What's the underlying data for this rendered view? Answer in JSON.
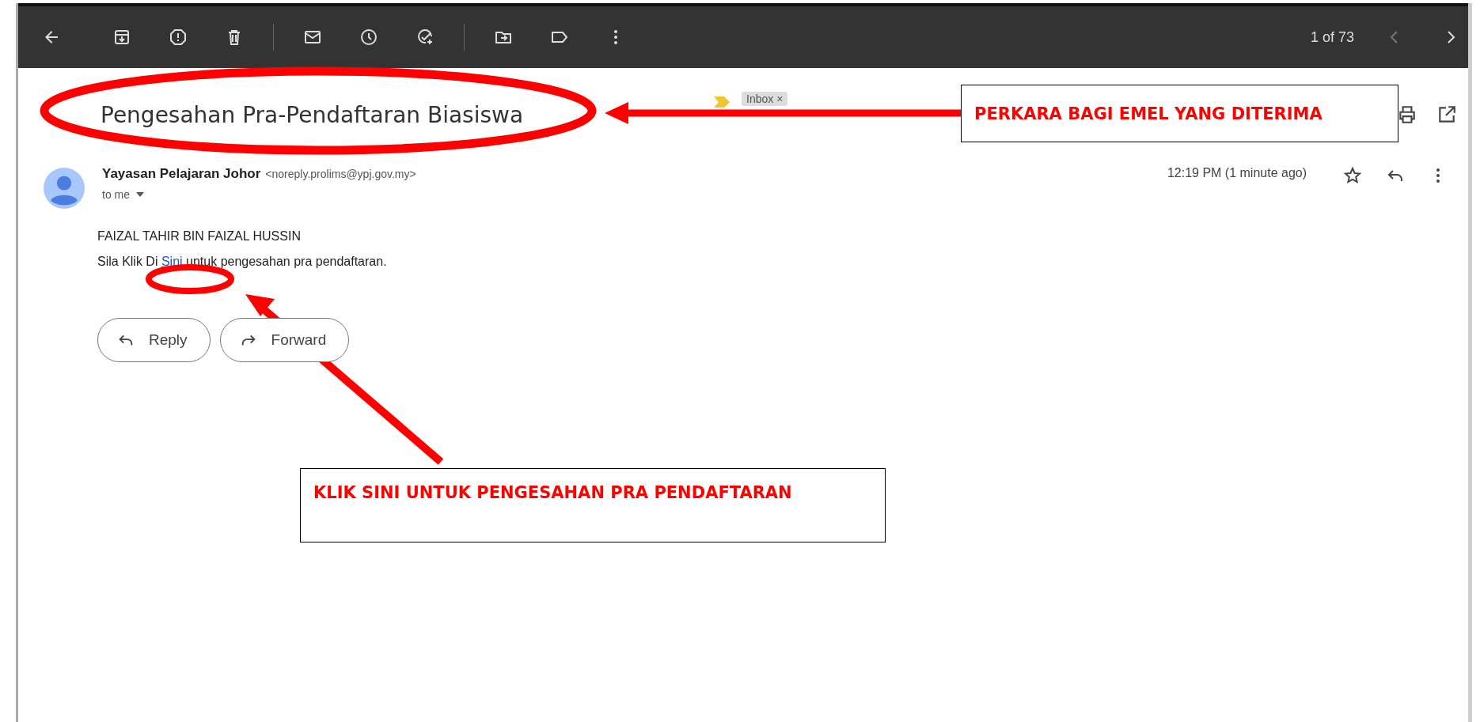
{
  "toolbar": {
    "page_counter": "1 of 73"
  },
  "email": {
    "subject": "Pengesahan Pra-Pendaftaran Biasiswa",
    "label": {
      "text": "Inbox",
      "remove": "×"
    },
    "sender": {
      "name": "Yayasan Pelajaran Johor",
      "address": "<noreply.prolims@ypj.gov.my>"
    },
    "recipient": "to me",
    "time": "12:19 PM (1 minute ago)",
    "body": [
      {
        "text": "FAIZAL TAHIR BIN FAIZAL HUSSIN"
      },
      {
        "before": "Sila Klik Di ",
        "link": "Sini",
        "after": " untuk pengesahan pra pendaftaran."
      }
    ],
    "buttons": [
      "Reply",
      "Forward"
    ]
  },
  "annotations": [
    {
      "text": "PERKARA BAGI EMEL YANG DITERIMA"
    },
    {
      "text": "KLIK SINI UNTUK PENGESAHAN PRA PENDAFTARAN"
    }
  ]
}
